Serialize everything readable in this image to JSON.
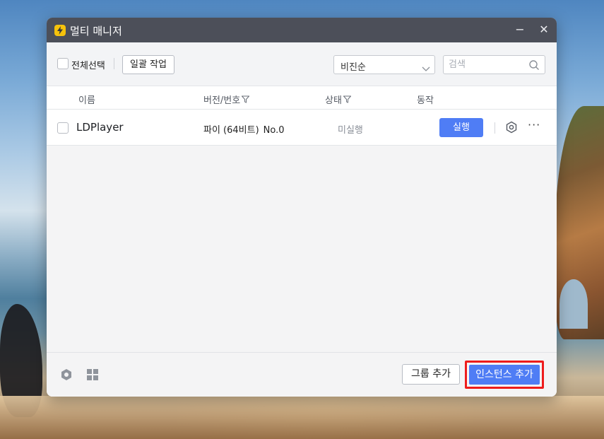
{
  "window": {
    "title": "멀티 매니저",
    "minimize_symbol": "−",
    "close_symbol": "✕",
    "accent_color": "#4f7df5",
    "titlebar_color": "#4c4f59"
  },
  "toolbar": {
    "select_all_label": "전체선택",
    "batch_button": "일괄 작업",
    "sort": {
      "selected": "비진순"
    },
    "search": {
      "placeholder": "검색",
      "value": ""
    }
  },
  "table": {
    "columns": [
      "이름",
      "버전/번호",
      "상태",
      "동작"
    ],
    "rows": [
      {
        "name": "LDPlayer",
        "version": "파이 (64비트)",
        "number": "No.0",
        "status": "미실행",
        "run_label": "실행",
        "more_symbol": "···"
      }
    ]
  },
  "footer": {
    "group_add_label": "그룹 추가",
    "add_instance_label": "인스턴스 추가",
    "highlight_color": "#ee1c1c"
  }
}
